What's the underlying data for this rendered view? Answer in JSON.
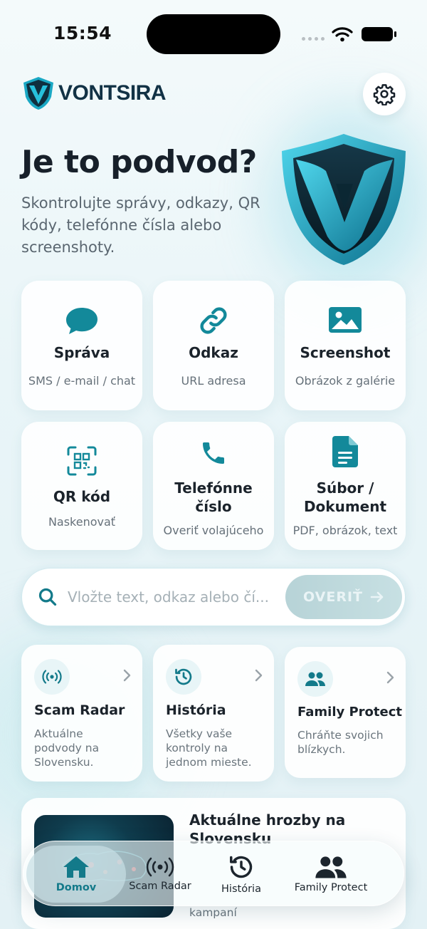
{
  "status_bar": {
    "time": "15:54"
  },
  "app": {
    "name": "VONTSIRA"
  },
  "hero": {
    "title": "Je to podvod?",
    "subtitle": "Skontrolujte správy, odkazy, QR kódy, telefónne čísla alebo screenshoty."
  },
  "check_types": [
    {
      "icon": "chat-bubble-icon",
      "title": "Správa",
      "subtitle": "SMS / e-mail / chat"
    },
    {
      "icon": "link-icon",
      "title": "Odkaz",
      "subtitle": "URL adresa"
    },
    {
      "icon": "image-icon",
      "title": "Screenshot",
      "subtitle": "Obrázok z galérie"
    },
    {
      "icon": "qr-code-icon",
      "title": "QR kód",
      "subtitle": "Naskenovať"
    },
    {
      "icon": "phone-icon",
      "title": "Telefónne číslo",
      "subtitle": "Overiť volajúceho"
    },
    {
      "icon": "document-icon",
      "title": "Súbor / Dokument",
      "subtitle": "PDF, obrázok, text"
    }
  ],
  "search": {
    "placeholder": "Vložte text, odkaz alebo čí...",
    "button_label": "OVERIŤ"
  },
  "features": [
    {
      "icon": "radar-icon",
      "title": "Scam Radar",
      "description": "Aktuálne podvody na Slovensku."
    },
    {
      "icon": "history-icon",
      "title": "História",
      "description": "Všetky vaše kontroly na jednom mieste."
    },
    {
      "icon": "family-icon",
      "title": "Family Protect",
      "description": "Chráňte svojich blízkych."
    }
  ],
  "news": {
    "title": "Aktuálne hrozby na Slovensku",
    "description": "kampaní"
  },
  "tab_bar": [
    {
      "icon": "home-icon",
      "label": "Domov",
      "active": true
    },
    {
      "icon": "radar-icon",
      "label": "Scam Radar",
      "active": false
    },
    {
      "icon": "history-icon",
      "label": "História",
      "active": false
    },
    {
      "icon": "family-icon",
      "label": "Family Protect",
      "active": false
    }
  ],
  "colors": {
    "accent": "#137a8a",
    "text": "#17202a",
    "muted": "#66717a",
    "shield": "#1fa9c7"
  }
}
